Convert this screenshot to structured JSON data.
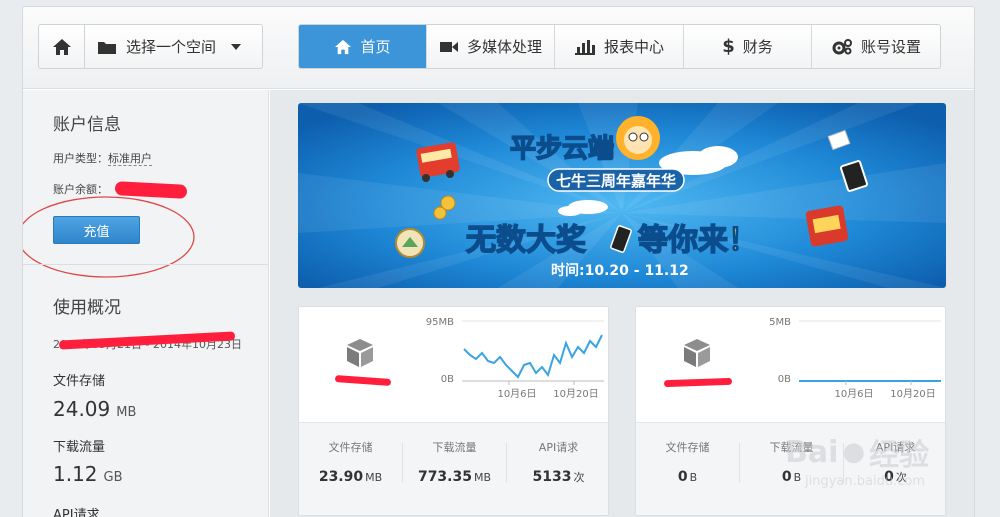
{
  "topbar": {
    "home_icon": "home-icon",
    "space_selector": {
      "label": "选择一个空间",
      "icon": "folder-icon"
    }
  },
  "nav": {
    "items": [
      {
        "label": "首页",
        "icon": "home-icon",
        "active": true
      },
      {
        "label": "多媒体处理",
        "icon": "video-camera-icon",
        "active": false
      },
      {
        "label": "报表中心",
        "icon": "bar-chart-icon",
        "active": false
      },
      {
        "label": "财务",
        "icon": "dollar-icon",
        "active": false
      },
      {
        "label": "账号设置",
        "icon": "gears-icon",
        "active": false
      }
    ]
  },
  "account": {
    "title": "账户信息",
    "user_type_label": "用户类型：",
    "user_type_value": "标准用户",
    "balance_label": "账户余额：",
    "recharge_label": "充值"
  },
  "usage": {
    "title": "使用概况",
    "date_range_start": "2014年09月21日",
    "date_range_end": "2014年10月23日",
    "storage_label": "文件存储",
    "storage_value": "24.09",
    "storage_unit": "MB",
    "download_label": "下载流量",
    "download_value": "1.12",
    "download_unit": "GB",
    "api_label": "API请求"
  },
  "banner": {
    "headline_top": "平步云端",
    "subheadline": "七牛三周年嘉年华",
    "headline_main_1": "无数大奖",
    "headline_main_2": "等你来！",
    "time_text": "时间:10.20 - 11.12"
  },
  "buckets": [
    {
      "icon": "bucket-box-icon",
      "chart_ymax": "95MB",
      "chart_ymin": "0B",
      "x_ticks": [
        "10月6日",
        "10月20日"
      ],
      "stats": [
        {
          "label": "文件存储",
          "value": "23.90",
          "unit": "MB"
        },
        {
          "label": "下载流量",
          "value": "773.35",
          "unit": "MB"
        },
        {
          "label": "API请求",
          "value": "5133",
          "unit": "次"
        }
      ]
    },
    {
      "icon": "bucket-box-icon",
      "chart_ymax": "5MB",
      "chart_ymin": "0B",
      "x_ticks": [
        "10月6日",
        "10月20日"
      ],
      "stats": [
        {
          "label": "文件存储",
          "value": "0",
          "unit": "B"
        },
        {
          "label": "下载流量",
          "value": "0",
          "unit": "B"
        },
        {
          "label": "API请求",
          "value": "0",
          "unit": "次"
        }
      ]
    }
  ],
  "watermark": {
    "brand": "Bai",
    "brand2": "经验",
    "url": "jingyan.baidu.com"
  },
  "colors": {
    "accent": "#3b95d8",
    "chart_line": "#3aa3e3",
    "redaction": "#ff1f3d",
    "annotation_circle": "#e04848"
  }
}
